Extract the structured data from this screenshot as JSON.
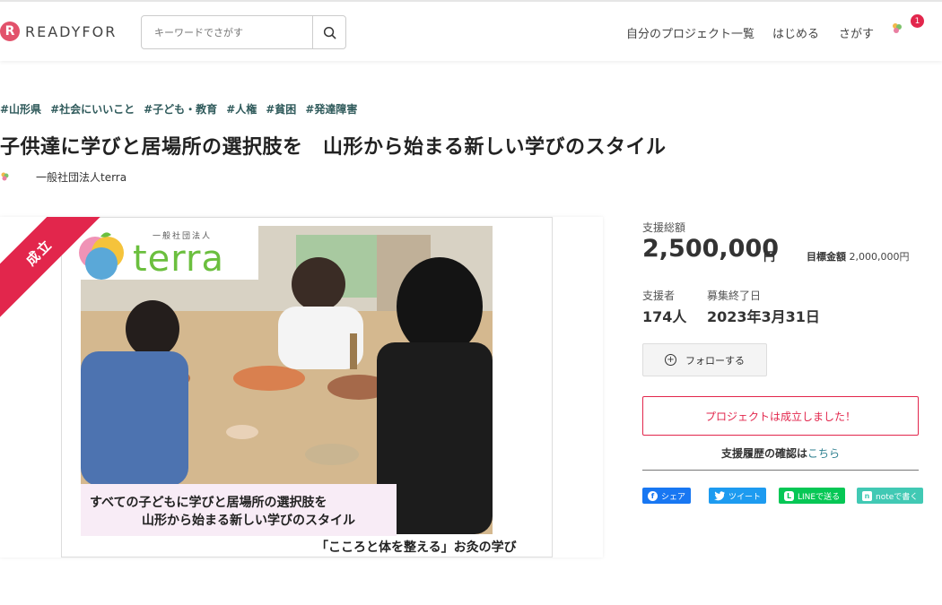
{
  "header": {
    "logo_text": "READYFOR",
    "search_placeholder": "キーワードでさがす",
    "nav": [
      "自分のプロジェクト一覧",
      "はじめる",
      "さがす"
    ],
    "notification_count": "1"
  },
  "project": {
    "tags": [
      "#山形県",
      "#社会にいいこと",
      "#子ども・教育",
      "#人権",
      "#貧困",
      "#発達障害"
    ],
    "title": "子供達に学びと居場所の選択肢を　山形から始まる新しい学びのスタイル",
    "owner": "一般社団法人terra"
  },
  "visual": {
    "ribbon": "成立",
    "logo_sub": "一般社団法人",
    "logo_word": "terra",
    "caption_line1": "すべての子どもに学びと居場所の選択肢を",
    "caption_line2": "山形から始まる新しい学びのスタイル",
    "caption_bottom": "「こころと体を整える」お灸の学び"
  },
  "stats": {
    "total_label": "支援総額",
    "total_value": "2,500,000",
    "total_unit": "円",
    "goal_label": "目標金額",
    "goal_value": "2,000,000円",
    "supporters_label": "支援者",
    "supporters_value": "174人",
    "deadline_label": "募集終了日",
    "deadline_value": "2023年3月31日"
  },
  "actions": {
    "follow_label": "フォローする",
    "success_message": "プロジェクトは成立しました！",
    "history_text": "支援履歴の確認は",
    "history_link": "こちら"
  },
  "share": {
    "facebook": "シェア",
    "twitter": "ツイート",
    "line": "LINEで送る",
    "note": "noteで書く"
  },
  "colors": {
    "brand": "#e2264c",
    "tag": "#2f5a5b",
    "facebook": "#1877f2",
    "twitter": "#1d9bf0",
    "line": "#06c755",
    "note": "#41c9b4"
  }
}
